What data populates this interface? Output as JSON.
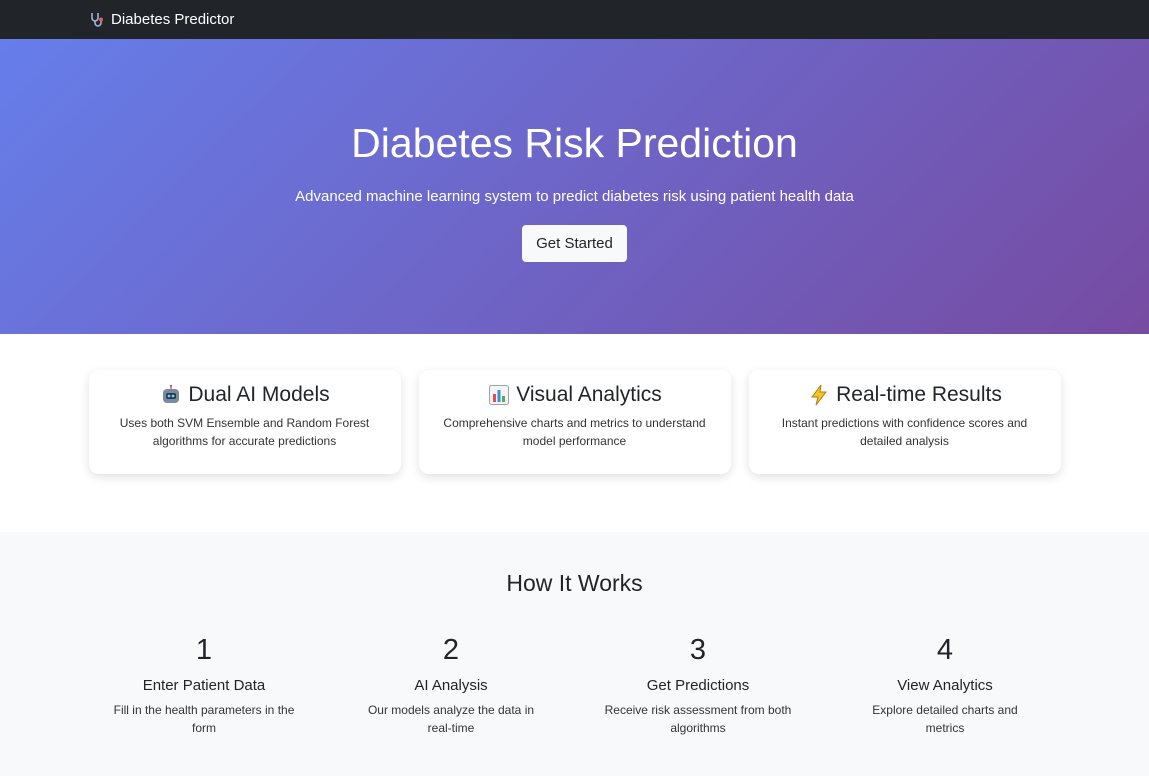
{
  "navbar": {
    "brand": "Diabetes Predictor",
    "brand_icon": "stethoscope-icon"
  },
  "hero": {
    "title": "Diabetes Risk Prediction",
    "subtitle": "Advanced machine learning system to predict diabetes risk using patient health data",
    "cta_label": "Get Started",
    "gradient_start": "#667eea",
    "gradient_end": "#764ba2"
  },
  "features": [
    {
      "icon": "robot-icon",
      "title": "Dual AI Models",
      "text": "Uses both SVM Ensemble and Random Forest algorithms for accurate predictions"
    },
    {
      "icon": "bar-chart-icon",
      "title": "Visual Analytics",
      "text": "Comprehensive charts and metrics to understand model performance"
    },
    {
      "icon": "lightning-icon",
      "title": "Real-time Results",
      "text": "Instant predictions with confidence scores and detailed analysis"
    }
  ],
  "how": {
    "title": "How It Works",
    "steps": [
      {
        "num": "1",
        "title": "Enter Patient Data",
        "text": "Fill in the health parameters in the form"
      },
      {
        "num": "2",
        "title": "AI Analysis",
        "text": "Our models analyze the data in real-time"
      },
      {
        "num": "3",
        "title": "Get Predictions",
        "text": "Receive risk assessment from both algorithms"
      },
      {
        "num": "4",
        "title": "View Analytics",
        "text": "Explore detailed charts and metrics"
      }
    ]
  }
}
